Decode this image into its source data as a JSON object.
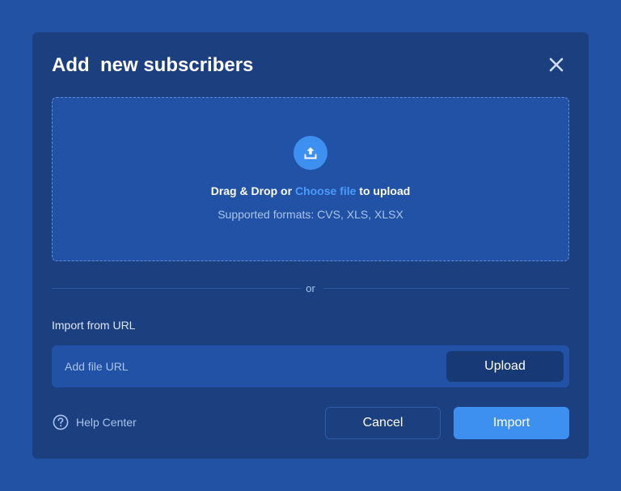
{
  "modal": {
    "title": "Add  new subscribers",
    "close_icon": "close-icon"
  },
  "dropzone": {
    "icon": "upload-icon",
    "text_before": "Drag & Drop or ",
    "link_text": "Choose file",
    "text_after": " to upload",
    "formats": "Supported formats: CVS, XLS, XLSX"
  },
  "divider": {
    "text": "or"
  },
  "url_import": {
    "label": "Import from URL",
    "placeholder": "Add file URL",
    "upload_label": "Upload"
  },
  "footer": {
    "help_icon": "help-circle-icon",
    "help_label": "Help Center",
    "cancel_label": "Cancel",
    "import_label": "Import"
  },
  "colors": {
    "background": "#2152a3",
    "modal": "#1b3f7f",
    "accent": "#3d8ff0",
    "link": "#4a9bff"
  }
}
